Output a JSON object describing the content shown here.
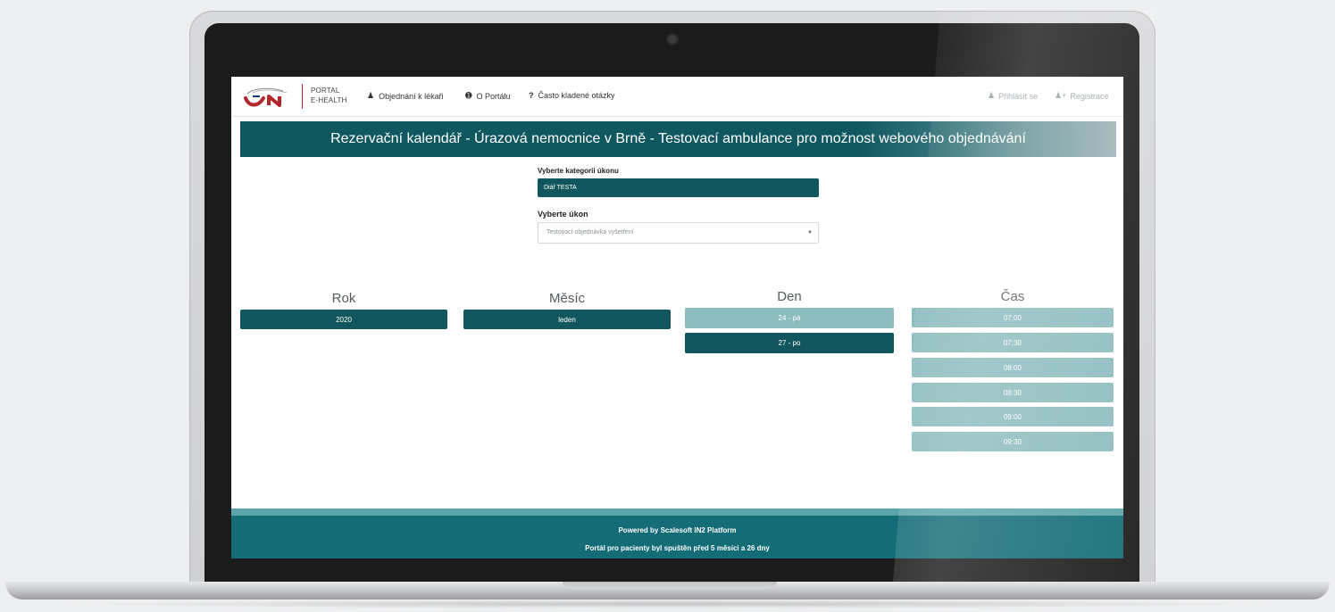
{
  "header": {
    "portal_line1": "PORTAL",
    "portal_line2": "E-HEALTH",
    "nav": [
      {
        "label": "Objednání k lékaři",
        "icon": "user-md-icon"
      },
      {
        "label": "O Portálu",
        "icon": "info-circle-icon"
      },
      {
        "label": "Často kladené otázky",
        "icon": "question-icon"
      }
    ],
    "login_label": "Přihlásit se",
    "register_label": "Registrace"
  },
  "banner": {
    "title": "Rezervační kalendář - Úrazová nemocnice v Brně - Testovací ambulance pro možnost webového objednávání"
  },
  "form": {
    "category_label": "Vyberte kategorii úkonu",
    "category_value": "Diář TESTA",
    "ukon_label": "Vyberte úkon",
    "ukon_value": "Testovací objednávka vyšetření"
  },
  "calendar": {
    "year_heading": "Rok",
    "month_heading": "Měsíc",
    "day_heading": "Den",
    "time_heading": "Čas",
    "years": [
      "2020"
    ],
    "months": [
      "leden"
    ],
    "days": [
      {
        "label": "24 - pá",
        "selected": false
      },
      {
        "label": "27 - po",
        "selected": true
      }
    ],
    "times": [
      "07:00",
      "07:30",
      "08:00",
      "08:30",
      "09:00",
      "09:30"
    ]
  },
  "footer": {
    "powered": "Powered by Scalesoft IN2 Platform",
    "uptime": "Portál pro pacienty byl spuštěn před 5 měsíci a 26 dny"
  },
  "colors": {
    "primary": "#12565d",
    "light": "#8dbcbe",
    "footer": "#136c76",
    "logo_red": "#b3262d"
  }
}
